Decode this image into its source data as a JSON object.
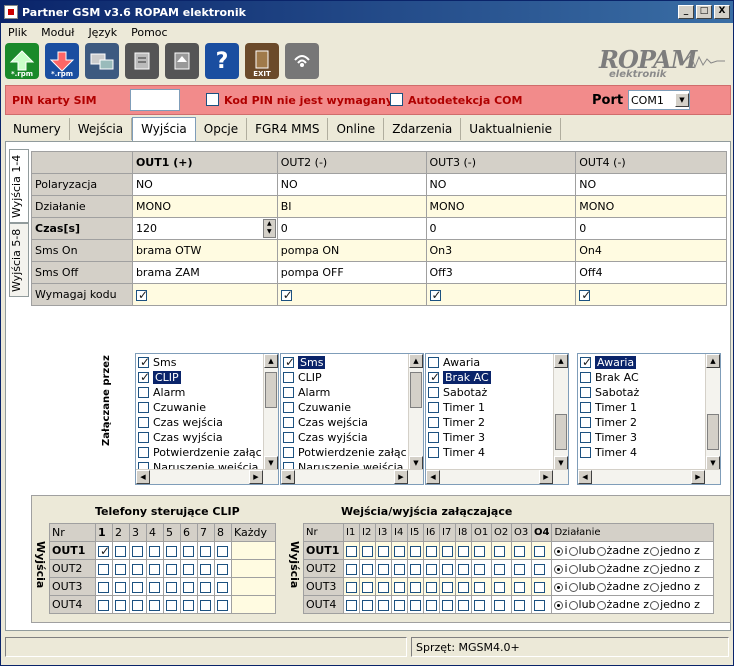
{
  "window": {
    "title": "Partner GSM v3.6 ROPAM elektronik",
    "btn_min": "_",
    "btn_max": "□",
    "btn_close": "X"
  },
  "menu": [
    "Plik",
    "Moduł",
    "Język",
    "Pomoc"
  ],
  "toolbar": {
    "icons": [
      "upload-rpm-icon",
      "download-rpm-icon",
      "connect-icon",
      "module-read-icon",
      "module-write-icon",
      "help-icon",
      "exit-icon",
      "wireless-icon"
    ],
    "sub_labels": [
      "*.rpm",
      "*.rpm",
      "",
      "",
      "",
      "",
      "EXIT",
      ""
    ]
  },
  "logo": {
    "main": "ROPAM",
    "sub": "elektronik"
  },
  "simbar": {
    "pin_label": "PIN karty SIM",
    "pin_value": "",
    "kod_pin_label": "Kod PIN nie jest wymagany",
    "autodet_label": "Autodetekcja COM",
    "port_label": "Port",
    "port_value": "COM1",
    "bg_color": "#f28b8b"
  },
  "tabs": [
    "Numery",
    "Wejścia",
    "Wyjścia",
    "Opcje",
    "FGR4 MMS",
    "Online",
    "Zdarzenia",
    "Uaktualnienie"
  ],
  "vtabs": [
    "Wyjścia 1-4",
    "Wyjścia 5-8"
  ],
  "grid": {
    "headers": [
      "OUT1 (+)",
      "OUT2 (-)",
      "OUT3  (-)",
      "OUT4 (-)"
    ],
    "row_labels": [
      "Polaryzacja",
      "Działanie",
      "Czas[s]",
      "Sms On",
      "Sms Off",
      "Wymagaj kodu"
    ],
    "values": [
      [
        "NO",
        "NO",
        "NO",
        "NO"
      ],
      [
        "MONO",
        "BI",
        "MONO",
        "MONO"
      ],
      [
        "120",
        "0",
        "0",
        "0"
      ],
      [
        "brama OTW",
        "pompa ON",
        "On3",
        "On4"
      ],
      [
        "brama ZAM",
        "pompa OFF",
        "Off3",
        "Off4"
      ]
    ],
    "require_code": [
      true,
      true,
      true,
      true
    ]
  },
  "zal_label": "Załączane przez",
  "lists": [
    {
      "items": [
        "Sms",
        "CLIP",
        "Alarm",
        "Czuwanie",
        "Czas wejścia",
        "Czas wyjścia",
        "Potwierdzenie załąc",
        "Naruszenie weiścia"
      ],
      "checked": [
        true,
        true,
        false,
        false,
        false,
        false,
        false,
        false
      ],
      "selected": 1
    },
    {
      "items": [
        "Sms",
        "CLIP",
        "Alarm",
        "Czuwanie",
        "Czas wejścia",
        "Czas wyjścia",
        "Potwierdzenie załąc",
        "Naruszenie weiścia"
      ],
      "checked": [
        true,
        false,
        false,
        false,
        false,
        false,
        false,
        false
      ],
      "selected": 0
    },
    {
      "items": [
        "Awaria",
        "Brak AC",
        "Sabotaż",
        "Timer 1",
        "Timer 2",
        "Timer 3",
        "Timer 4"
      ],
      "checked": [
        false,
        true,
        false,
        false,
        false,
        false,
        false
      ],
      "selected": 1
    },
    {
      "items": [
        "Awaria",
        "Brak AC",
        "Sabotaż",
        "Timer 1",
        "Timer 2",
        "Timer 3",
        "Timer 4"
      ],
      "checked": [
        true,
        false,
        false,
        false,
        false,
        false,
        false
      ],
      "selected": 0
    }
  ],
  "clip": {
    "title": "Telefony sterujące CLIP",
    "side_label": "Wyjścia",
    "cols": [
      "Nr",
      "1",
      "2",
      "3",
      "4",
      "5",
      "6",
      "7",
      "8",
      "Każdy"
    ],
    "rows": [
      "OUT1",
      "OUT2",
      "OUT3",
      "OUT4"
    ],
    "checked_cell": [
      0,
      1
    ]
  },
  "wz": {
    "title": "Wejścia/wyjścia załączające",
    "side_label": "Wyjścia",
    "cols": [
      "Nr",
      "I1",
      "I2",
      "I3",
      "I4",
      "I5",
      "I6",
      "I7",
      "I8",
      "O1",
      "O2",
      "O3",
      "O4",
      "Działanie"
    ],
    "rows": [
      "OUT1",
      "OUT2",
      "OUT3",
      "OUT4"
    ],
    "radio_labels": [
      "i",
      "lub",
      "żadne z",
      "jedno z"
    ]
  },
  "status": {
    "left": "",
    "hw": "Sprzęt: MGSM4.0+"
  }
}
